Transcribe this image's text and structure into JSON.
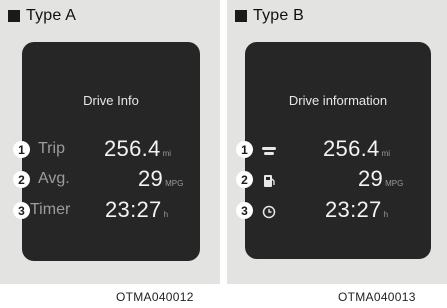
{
  "type_a": {
    "title": "Type A",
    "screen_title": "Drive Info",
    "rows": [
      {
        "number": "1",
        "label": "Trip",
        "value": "256.4",
        "unit": "mi"
      },
      {
        "number": "2",
        "label": "Avg.",
        "value": "29",
        "unit": "MPG"
      },
      {
        "number": "3",
        "label": "Timer",
        "value": "23:27",
        "unit": "h"
      }
    ],
    "caption": "OTMA040012"
  },
  "type_b": {
    "title": "Type B",
    "screen_title": "Drive information",
    "rows": [
      {
        "number": "1",
        "icon": "car-trip-icon",
        "value": "256.4",
        "unit": "mi"
      },
      {
        "number": "2",
        "icon": "fuel-pump-icon",
        "value": "29",
        "unit": "MPG"
      },
      {
        "number": "3",
        "icon": "clock-icon",
        "value": "23:27",
        "unit": "h"
      }
    ],
    "caption": "OTMA040013"
  },
  "colors": {
    "panel_background": "#e3e3e1",
    "screen_background": "#262626",
    "value_text": "#f3f3f3",
    "label_text": "#9c9c9c"
  }
}
